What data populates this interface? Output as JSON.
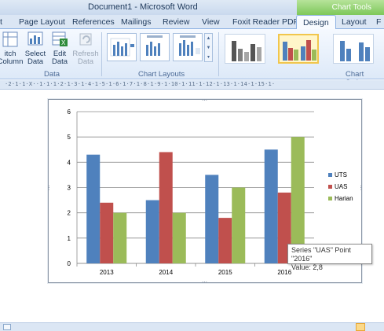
{
  "titlebar": {
    "title": "Document1  -  Microsoft Word",
    "context_title": "Chart Tools"
  },
  "tabs": [
    {
      "label": "t"
    },
    {
      "label": "Page Layout"
    },
    {
      "label": "References"
    },
    {
      "label": "Mailings"
    },
    {
      "label": "Review"
    },
    {
      "label": "View"
    },
    {
      "label": "Foxit Reader PDF"
    },
    {
      "label": "Design"
    },
    {
      "label": "Layout"
    },
    {
      "label": "F"
    }
  ],
  "ribbon": {
    "data_group": {
      "label": "Data",
      "buttons": [
        {
          "label_line1": "itch",
          "label_line2": "Column",
          "icon": "switch-row-column-icon"
        },
        {
          "label_line1": "Select",
          "label_line2": "Data",
          "icon": "select-data-icon"
        },
        {
          "label_line1": "Edit",
          "label_line2": "Data",
          "icon": "edit-data-icon"
        },
        {
          "label_line1": "Refresh",
          "label_line2": "Data",
          "icon": "refresh-data-icon"
        }
      ]
    },
    "chart_layouts_label": "Chart Layouts",
    "chart_styles_label": "Chart Styles"
  },
  "ruler": {
    "text": "·2·1·1·X··1·1·1·2·1·3·1·4·1·5·1·6·1·7·1·8·1·9·1·10·1·11·1·12·1·13·1·14·1·15·1·"
  },
  "chart_data": {
    "type": "bar",
    "categories": [
      "2013",
      "2014",
      "2015",
      "2016"
    ],
    "series": [
      {
        "name": "UTS",
        "color": "#4f81bd",
        "values": [
          4.3,
          2.5,
          3.5,
          4.5
        ]
      },
      {
        "name": "UAS",
        "color": "#c0504d",
        "values": [
          2.4,
          4.4,
          1.8,
          2.8
        ]
      },
      {
        "name": "Harian",
        "color": "#9bbb59",
        "values": [
          2.0,
          2.0,
          3.0,
          5.0
        ]
      }
    ],
    "ylim": [
      0,
      6
    ],
    "yticks": [
      "0",
      "1",
      "2",
      "3",
      "4",
      "5",
      "6"
    ],
    "grid": true,
    "legend": "right",
    "title": "",
    "xlabel": "",
    "ylabel": ""
  },
  "tooltip": {
    "line1": "Series \"UAS\" Point \"2016\"",
    "line2": "Value: 2,8"
  }
}
